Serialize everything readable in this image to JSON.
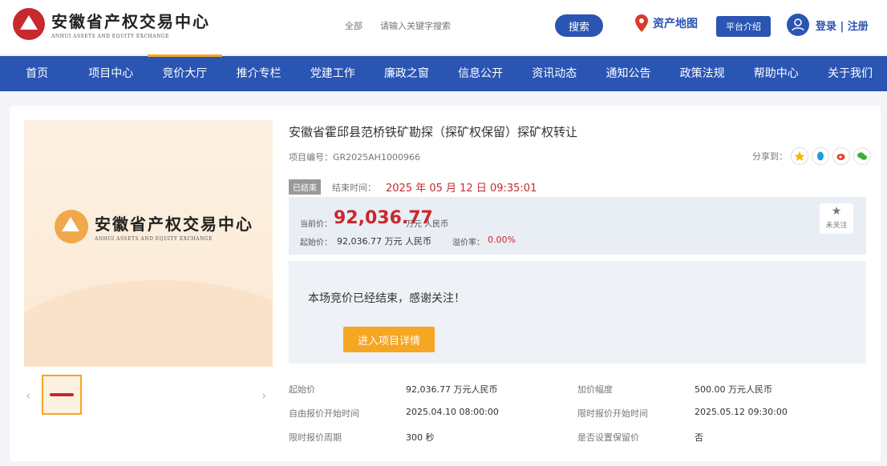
{
  "brand": {
    "name_cn": "安徽省产权交易中心",
    "name_en": "ANHUI ASSETS AND EQUITY EXCHANGE"
  },
  "search": {
    "category": "全部",
    "placeholder": "请输入关键字搜索",
    "button_label": "搜索"
  },
  "header": {
    "asset_map_label": "资产地图",
    "platform_intro_label": "平台介绍",
    "login_register_label": "登录 | 注册"
  },
  "nav": {
    "items": [
      {
        "label": "首页"
      },
      {
        "label": "项目中心"
      },
      {
        "label": "竞价大厅"
      },
      {
        "label": "推介专栏"
      },
      {
        "label": "党建工作"
      },
      {
        "label": "廉政之窗"
      },
      {
        "label": "信息公开"
      },
      {
        "label": "资讯动态"
      },
      {
        "label": "通知公告"
      },
      {
        "label": "政策法规"
      },
      {
        "label": "帮助中心"
      },
      {
        "label": "关于我们"
      }
    ],
    "active_index": 2
  },
  "project": {
    "title": "安徽省霍邱县范桥铁矿勘探（探矿权保留）探矿权转让",
    "number_label": "项目编号：",
    "number": "GR2025AH1000966",
    "share_label": "分享到：",
    "status_badge": "已结束",
    "end_time_label": "结束时间：",
    "end_time": "2025 年 05 月 12 日 09:35:01",
    "current_price_label": "当前价：",
    "current_price": "92,036.77",
    "current_price_unit": "万元 人民币",
    "start_price_label": "起始价：",
    "start_price": "92,036.77 万元 人民币",
    "premium_label": "溢价率：",
    "premium": "0.00%",
    "follow_label": "未关注",
    "end_message": "本场竞价已经结束，感谢关注！",
    "detail_button": "进入项目详情"
  },
  "info": {
    "rows": [
      [
        {
          "label": "起始价",
          "value": "92,036.77 万元人民币"
        },
        {
          "label": "加价幅度",
          "value": "500.00 万元人民币"
        }
      ],
      [
        {
          "label": "自由报价开始时间",
          "value": "2025.04.10 08:00:00"
        },
        {
          "label": "限时报价开始时间",
          "value": "2025.05.12 09:30:00"
        }
      ],
      [
        {
          "label": "限时报价周期",
          "value": "300 秒"
        },
        {
          "label": "是否设置保留价",
          "value": "否"
        }
      ]
    ]
  },
  "colors": {
    "primary_blue": "#2b55b3",
    "accent_orange": "#f5a623",
    "price_red": "#c8282e"
  },
  "icons": [
    "map-pin-icon",
    "user-icon",
    "star-icon",
    "qzone-icon",
    "qq-icon",
    "weibo-icon",
    "wechat-icon",
    "chevron-left-icon",
    "chevron-right-icon"
  ]
}
